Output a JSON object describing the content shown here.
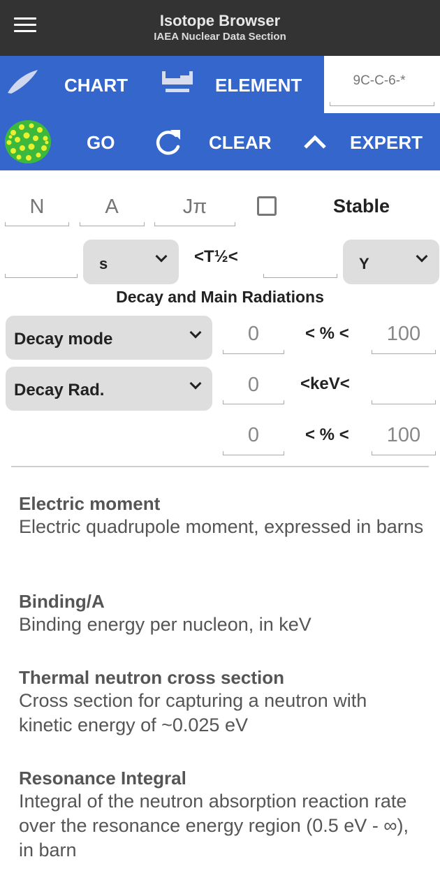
{
  "appbar": {
    "title": "Isotope Browser",
    "subtitle": "IAEA Nuclear Data Section",
    "menu_icon": "hamburger-menu-icon"
  },
  "toolbar": {
    "chart_label": "CHART",
    "chart_icon": "nuclide-chart-icon",
    "element_label": "ELEMENT",
    "element_icon": "periodic-table-icon",
    "search_value": "9C-C-6-*",
    "go_label": "GO",
    "go_icon": "nucleus-icon",
    "clear_label": "CLEAR",
    "clear_icon": "refresh-icon",
    "expert_label": "EXPERT",
    "expert_icon": "chevron-up-icon",
    "colors": {
      "bar": "#3466cc",
      "appbar": "#333333"
    }
  },
  "filters": {
    "n_placeholder": "N",
    "a_placeholder": "A",
    "jpi_placeholder": "Jπ",
    "stable_label": "Stable",
    "stable_checked": false,
    "halflife": {
      "min_value": "",
      "min_unit": "s",
      "label": "<T½<",
      "max_value": "",
      "max_unit": "Y"
    },
    "section_title": "Decay and Main Radiations",
    "decay_mode": {
      "selected": "Decay mode",
      "min": "0",
      "label": "< % <",
      "max": "100"
    },
    "decay_rad": {
      "selected": "Decay Rad.",
      "min": "0",
      "label": "<keV<",
      "max": ""
    },
    "intensity": {
      "min": "0",
      "label": "< % <",
      "max": "100"
    }
  },
  "info": [
    {
      "title": "Electric moment",
      "desc": "Electric quadrupole moment, expressed in barns"
    },
    {
      "title": "Binding/A",
      "desc": "Binding energy per nucleon, in keV"
    },
    {
      "title": "Thermal neutron cross section",
      "desc": "Cross section for capturing a neutron with kinetic energy of ~0.025 eV"
    },
    {
      "title": "Resonance Integral",
      "desc": "Integral of the neutron absorption reaction rate over the resonance energy region (0.5 eV - ∞), in barn"
    }
  ]
}
